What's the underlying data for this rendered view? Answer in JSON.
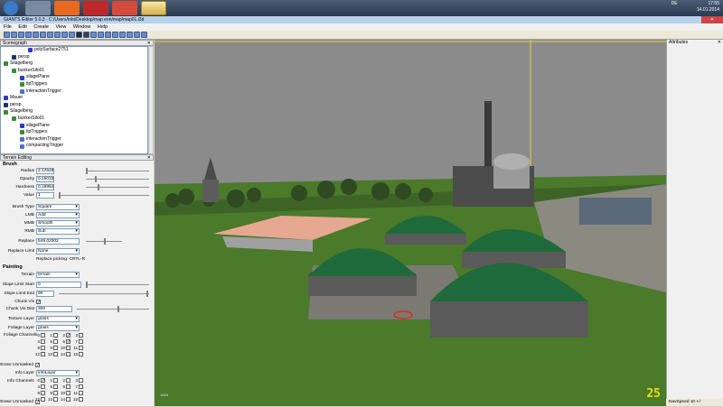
{
  "taskbar": {
    "tray_lang": "DE",
    "clock_time": "17:55",
    "clock_date": "14.01.2014"
  },
  "window": {
    "title": "GIANTS Editor 5.0.3 - C:/Users/tobi/Desktop/map eon/map/map01.i3d"
  },
  "menu": {
    "items": [
      "File",
      "Edit",
      "Create",
      "View",
      "Window",
      "Help"
    ]
  },
  "scenegraph": {
    "title": "Scenegraph",
    "nodes": [
      {
        "label": "polySurface2751",
        "indent": 3,
        "icon": "cube"
      },
      {
        "label": "persp",
        "indent": 1,
        "icon": "camera"
      },
      {
        "label": "Silagelberg",
        "indent": 0,
        "icon": "group"
      },
      {
        "label": "bunkerSilo01",
        "indent": 1,
        "icon": "group"
      },
      {
        "label": "silagePlane",
        "indent": 2,
        "icon": "cube"
      },
      {
        "label": "tipTriggers",
        "indent": 2,
        "icon": "group"
      },
      {
        "label": "interactionTrigger",
        "indent": 2,
        "icon": "trigger"
      },
      {
        "label": "Mauer",
        "indent": 0,
        "icon": "cube"
      },
      {
        "label": "persp",
        "indent": 0,
        "icon": "camera"
      },
      {
        "label": "Silagelberg",
        "indent": 0,
        "icon": "group"
      },
      {
        "label": "bunkerSilo01",
        "indent": 1,
        "icon": "group"
      },
      {
        "label": "silagePlane",
        "indent": 2,
        "icon": "cube"
      },
      {
        "label": "tipTriggers",
        "indent": 2,
        "icon": "group"
      },
      {
        "label": "interactionTrigger",
        "indent": 2,
        "icon": "trigger"
      },
      {
        "label": "compactingTrigger",
        "indent": 2,
        "icon": "trigger"
      }
    ]
  },
  "terrain": {
    "title": "Terrain Editing",
    "brush_heading": "Brush",
    "radius_label": "Radius",
    "radius_value": "2.17648",
    "opacity_label": "Opacity",
    "opacity_value": "0.15033",
    "hardness_label": "Hardness",
    "hardness_value": "0.18954",
    "value_label": "Value",
    "value_value": "1",
    "brushtype_label": "Brush Type",
    "brushtype_value": "Square",
    "lmb_label": "LMB",
    "lmb_value": "Add",
    "mmb_label": "MMB",
    "mmb_value": "Smooth",
    "rmb_label": "RMB",
    "rmb_value": "Sub",
    "replace_label": "Replace",
    "replace_value": "549.02002",
    "replacelimit_label": "Replace Limit",
    "replacelimit_value": "None",
    "replace_picking": "Replace picking: CRTL-R",
    "painting_heading": "Painting",
    "terrainsel_label": "Terrain",
    "terrainsel_value": "terrain",
    "slopestart_label": "Slope Limit Start",
    "slopestart_value": "0",
    "slopeend_label": "Slope Limit End",
    "slopeend_value": "90",
    "chunkvis_label": "Chunk Vis",
    "chunkvisdist_label": "Chunk Vis Dist",
    "chunkvisdist_value": "300",
    "texturelayer_label": "Texture Layer",
    "texturelayer_value": "grass",
    "foliagelayer_label": "Foliage Layer",
    "foliagelayer_value": "grass",
    "foliagechannels_label": "Foliage Channels",
    "erase_unmasked_label": "Erase Unmasked",
    "infolayer_label": "Info Layer",
    "infolayer_value": "infoLayer",
    "infochannels_label": "Info Channels",
    "channel_numbers": [
      "0",
      "1",
      "2",
      "3",
      "4",
      "5",
      "6",
      "7",
      "8",
      "9",
      "10",
      "11",
      "12",
      "13",
      "14",
      "15"
    ]
  },
  "attributes": {
    "title": "Attributes"
  },
  "viewport": {
    "fps": "25",
    "info": "1024"
  },
  "status": {
    "navspeed": "NavSpeed 10 +/-"
  },
  "colors": {
    "sky": "#8b8b8b",
    "grass": "#4a7a2a",
    "silo_roof": "#1f6a3a",
    "silo_wall": "#5a5a5a",
    "fps": "#e8e000"
  }
}
